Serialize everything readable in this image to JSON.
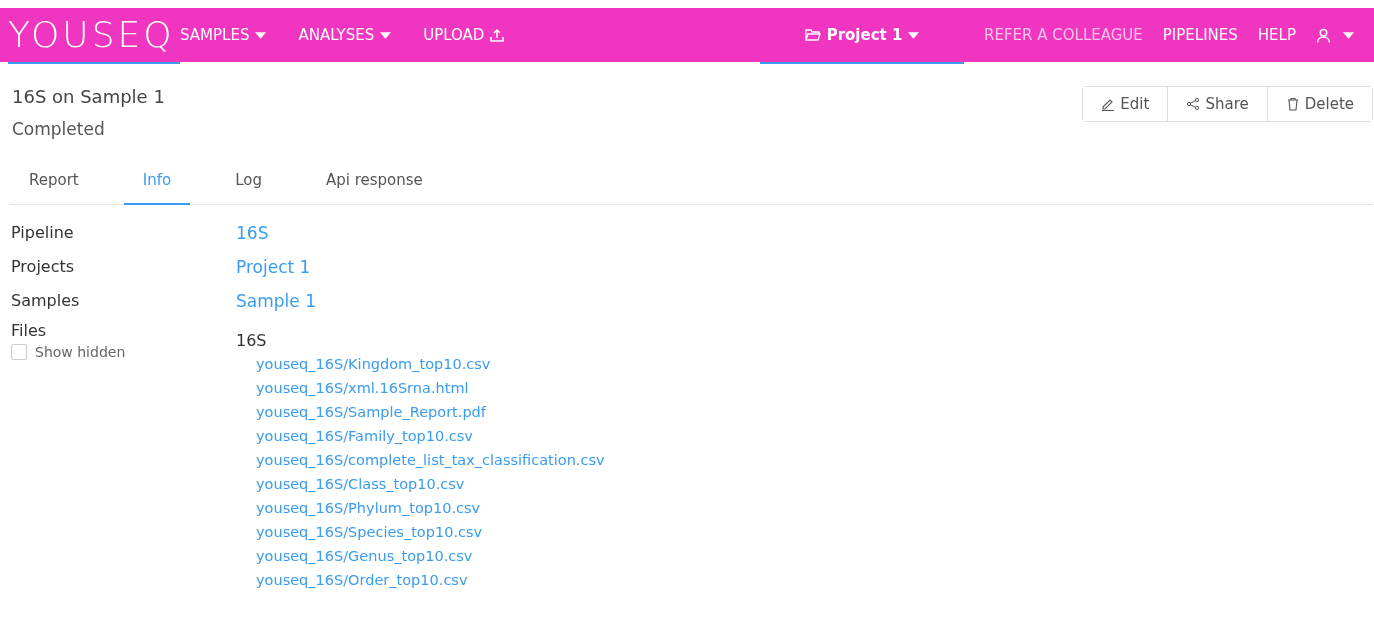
{
  "nav": {
    "logo": "YOUSEQ",
    "logo_selected": true,
    "items": [
      {
        "label": "SAMPLES",
        "kind": "dropdown"
      },
      {
        "label": "ANALYSES",
        "kind": "dropdown"
      },
      {
        "label": "UPLOAD",
        "kind": "upload"
      }
    ],
    "project": {
      "label": "Project 1",
      "selected": true
    },
    "right_items": [
      {
        "label": "REFER A COLLEAGUE",
        "disabled": true
      },
      {
        "label": "PIPELINES",
        "disabled": false
      },
      {
        "label": "HELP",
        "disabled": false
      }
    ]
  },
  "title": "16S on Sample 1",
  "status": "Completed",
  "actions": [
    {
      "label": "Edit",
      "kind": "edit"
    },
    {
      "label": "Share",
      "kind": "share"
    },
    {
      "label": "Delete",
      "kind": "delete"
    }
  ],
  "tabs": [
    {
      "label": "Report",
      "selected": false
    },
    {
      "label": "Info",
      "selected": true
    },
    {
      "label": "Log",
      "selected": false
    },
    {
      "label": "Api response",
      "selected": false
    }
  ],
  "info": [
    {
      "label": "Pipeline",
      "value": "16S"
    },
    {
      "label": "Projects",
      "value": "Project 1"
    },
    {
      "label": "Samples",
      "value": "Sample 1"
    }
  ],
  "files": {
    "label": "Files",
    "show_hidden": {
      "label": "Show hidden",
      "checked": false
    },
    "group": "16S",
    "items": [
      "youseq_16S/Kingdom_top10.csv",
      "youseq_16S/xml.16Srna.html",
      "youseq_16S/Sample_Report.pdf",
      "youseq_16S/Family_top10.csv",
      "youseq_16S/complete_list_tax_classification.csv",
      "youseq_16S/Class_top10.csv",
      "youseq_16S/Phylum_top10.csv",
      "youseq_16S/Species_top10.csv",
      "youseq_16S/Genus_top10.csv",
      "youseq_16S/Order_top10.csv"
    ]
  }
}
